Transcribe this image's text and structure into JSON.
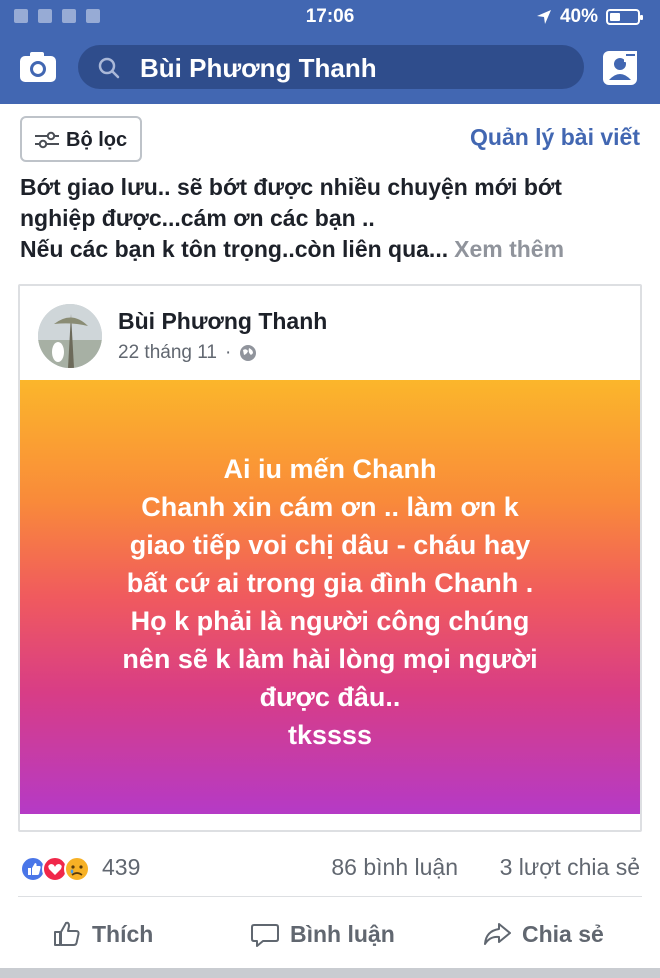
{
  "status": {
    "time": "17:06",
    "battery_text": "40%",
    "battery_level": 0.4
  },
  "header": {
    "search_value": "Bùi Phương Thanh"
  },
  "filter": {
    "label": "Bộ lọc",
    "manage_label": "Quản lý bài viết"
  },
  "post": {
    "lines": [
      "Bớt giao lưu.. sẽ bớt được nhiều chuyện mới bớt",
      "nghiệp được...cám ơn các bạn ..",
      "Nếu các bạn k tôn trọng..còn liên qua..."
    ],
    "see_more": "Xem thêm",
    "shared": {
      "author": "Bùi Phương Thanh",
      "date": "22 tháng 11",
      "bg_lines": [
        "Ai iu mến Chanh",
        "Chanh xin cám ơn .. làm ơn k",
        "giao tiếp voi chị dâu - cháu hay",
        "bất cứ ai trong gia đình Chanh .",
        "Họ k phải là người công chúng",
        "nên sẽ k làm hài lòng mọi người",
        "được đâu..",
        "tkssss"
      ]
    },
    "reactions_count": "439",
    "comments": "86 bình luận",
    "shares": "3 lượt chia sẻ"
  },
  "actions": {
    "like": "Thích",
    "comment": "Bình luận",
    "share": "Chia sẻ"
  },
  "colors": {
    "brand": "#4267b2",
    "like_blue": "#4a76e8",
    "love_red": "#f0284a",
    "sad_yellow": "#f7b125"
  }
}
